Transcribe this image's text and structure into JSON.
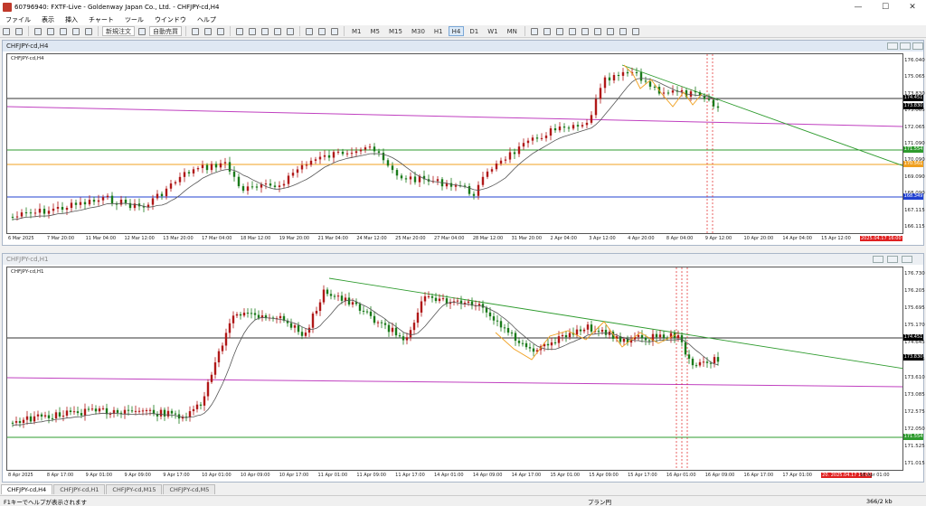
{
  "window": {
    "title": "60796940: FXTF-Live - Goldenway Japan Co., Ltd. - CHFJPY-cd,H4"
  },
  "menu": [
    "ファイル",
    "表示",
    "挿入",
    "チャート",
    "ツール",
    "ウインドウ",
    "ヘルプ"
  ],
  "toolbar": {
    "new_order_label": "新規注文",
    "auto_trade_label": "自動売買",
    "timeframes": [
      "M1",
      "M5",
      "M15",
      "M30",
      "H1",
      "H4",
      "D1",
      "W1",
      "MN"
    ],
    "selected_timeframe": "H4"
  },
  "chart_h4": {
    "window_title": "CHFJPY-cd,H4",
    "symbol_label": "CHFJPY-cd,H4",
    "price_ticks": [
      "176.040",
      "175.065",
      "173.830",
      "173.065",
      "172.065",
      "171.090",
      "170.090",
      "169.090",
      "168.090",
      "167.115",
      "166.115"
    ],
    "tags": {
      "current_price": "174.451",
      "bid": "173.830",
      "green_level": "171.554",
      "orange_level": "170.561",
      "blue_level": "168.349"
    },
    "time_labels": [
      "6 Mar 2025",
      "7 Mar 20:00",
      "11 Mar 04:00",
      "12 Mar 12:00",
      "13 Mar 20:00",
      "17 Mar 04:00",
      "18 Mar 12:00",
      "19 Mar 20:00",
      "21 Mar 04:00",
      "24 Mar 12:00",
      "25 Mar 20:00",
      "27 Mar 04:00",
      "28 Mar 12:00",
      "31 Mar 20:00",
      "2 Apr 04:00",
      "3 Apr 12:00",
      "4 Apr 20:00",
      "8 Apr 04:00",
      "9 Apr 12:00",
      "10 Apr 20:00",
      "14 Apr 04:00",
      "15 Apr 12:00",
      "2025.04.17 16:00"
    ]
  },
  "chart_h1": {
    "window_title": "CHFJPY-cd,H1",
    "symbol_label": "CHFJPY-cd,H1",
    "price_ticks": [
      "176.730",
      "176.205",
      "175.695",
      "175.170",
      "174.645",
      "174.135",
      "173.610",
      "173.085",
      "172.575",
      "172.050",
      "171.525",
      "171.015"
    ],
    "tags": {
      "current_price": "174.451",
      "bid": "173.830",
      "green_level": "171.554"
    },
    "time_labels": [
      "8 Apr 2025",
      "8 Apr 17:00",
      "9 Apr 01:00",
      "9 Apr 09:00",
      "9 Apr 17:00",
      "10 Apr 01:00",
      "10 Apr 09:00",
      "10 Apr 17:00",
      "11 Apr 01:00",
      "11 Apr 09:00",
      "11 Apr 17:00",
      "14 Apr 01:00",
      "14 Apr 09:00",
      "14 Apr 17:00",
      "15 Apr 01:00",
      "15 Apr 09:00",
      "15 Apr 17:00",
      "16 Apr 01:00",
      "16 Apr 09:00",
      "16 Apr 17:00",
      "17 Apr 01:00",
      "20. 2025.04.17 16:00",
      "18 Apr 01:00"
    ]
  },
  "tabs": [
    "CHFJPY-cd,H4",
    "CHFJPY-cd,H1",
    "CHFJPY-cd,M15",
    "CHFJPY-cd,M5"
  ],
  "active_tab": "CHFJPY-cd,H4",
  "status": {
    "help": "F1キーでヘルプが表示されます",
    "profile": "プラン円",
    "traffic": "366/2 kb"
  },
  "colors": {
    "green_line": "#2e9b2e",
    "orange_line": "#f0a020",
    "blue_line": "#2040d0",
    "purple_line": "#c040c0",
    "candle_red": "#b01818",
    "candle_green": "#1a7a1a",
    "tag_black": "#000000",
    "tag_red": "#e02020"
  }
}
